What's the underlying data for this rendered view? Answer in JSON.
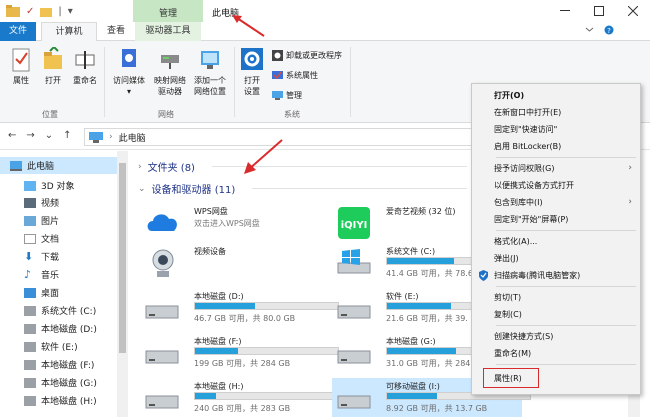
{
  "titlebar": {
    "manage_label": "管理",
    "window_title": "此电脑",
    "qat_check": "✓",
    "qat_divider": "|",
    "qat_dropdown": "▾"
  },
  "tabs": {
    "file": "文件",
    "computer": "计算机",
    "view": "查看",
    "driver_tools": "驱动器工具"
  },
  "ribbon": {
    "location": {
      "properties": "属性",
      "open": "打开",
      "rename": "重命名",
      "label": "位置"
    },
    "network": {
      "access_media": "访问媒体",
      "map_drive": "映射网络\n驱动器",
      "add_location": "添加一个\n网络位置",
      "label": "网络"
    },
    "system": {
      "open_settings": "打开\n设置",
      "uninstall": "卸载或更改程序",
      "sys_properties": "系统属性",
      "manage": "管理",
      "label": "系统"
    }
  },
  "address": {
    "path": "此电脑"
  },
  "sidebar": {
    "items": [
      {
        "label": "此电脑",
        "selected": true
      },
      {
        "label": "3D 对象"
      },
      {
        "label": "视频"
      },
      {
        "label": "图片"
      },
      {
        "label": "文档"
      },
      {
        "label": "下载"
      },
      {
        "label": "音乐"
      },
      {
        "label": "桌面"
      },
      {
        "label": "系统文件 (C:)"
      },
      {
        "label": "本地磁盘 (D:)"
      },
      {
        "label": "软件 (E:)"
      },
      {
        "label": "本地磁盘 (F:)"
      },
      {
        "label": "本地磁盘 (G:)"
      },
      {
        "label": "本地磁盘 (H:)"
      }
    ]
  },
  "content": {
    "folders_header": "文件夹 (8)",
    "devices_header": "设备和驱动器 (11)",
    "tiles": [
      {
        "name": "WPS网盘",
        "sub": "双击进入WPS网盘"
      },
      {
        "name": "爱奇艺视频 (32 位)"
      },
      {
        "name": "视频设备"
      },
      {
        "name": "系统文件 (C:)",
        "free": "41.4 GB 可用，共 78.6 GB",
        "fill": 0.47
      },
      {
        "name": "本地磁盘 (D:)",
        "free": "46.7 GB 可用，共 80.0 GB",
        "fill": 0.42
      },
      {
        "name": "软件 (E:)",
        "free": "21.6 GB 可用，共 39.",
        "fill": 0.45
      },
      {
        "name": "本地磁盘 (F:)",
        "free": "199 GB 可用，共 284 GB",
        "fill": 0.3
      },
      {
        "name": "本地磁盘 (G:)",
        "free": "31.0 GB 可用，共 284 GB",
        "fill": 0.48
      },
      {
        "name": "本地磁盘 (H:)",
        "free": "240 GB 可用，共 283 GB",
        "fill": 0.15
      },
      {
        "name": "可移动磁盘 (I:)",
        "free": "8.92 GB 可用，共 13.7 GB",
        "fill": 0.35
      }
    ]
  },
  "context_menu": {
    "items": [
      {
        "label": "打开(O)",
        "bold": true
      },
      {
        "label": "在新窗口中打开(E)"
      },
      {
        "label": "固定到\"快速访问\""
      },
      {
        "label": "启用 BitLocker(B)"
      },
      {
        "label": "授予访问权限(G)",
        "submenu": true
      },
      {
        "label": "以便携式设备方式打开"
      },
      {
        "label": "包含到库中(I)",
        "submenu": true
      },
      {
        "label": "固定到\"开始\"屏幕(P)"
      },
      {
        "label": "格式化(A)..."
      },
      {
        "label": "弹出(J)"
      },
      {
        "label": "扫描病毒(腾讯电脑管家)"
      },
      {
        "label": "剪切(T)"
      },
      {
        "label": "复制(C)"
      },
      {
        "label": "创建快捷方式(S)"
      },
      {
        "label": "重命名(M)"
      },
      {
        "label": "属性(R)"
      }
    ]
  },
  "colors": {
    "accent": "#1979ca",
    "manage_tab": "#c6e6c4",
    "drive_bar": "#26a0da",
    "selection": "#cce8ff",
    "annotation": "#d92b2b"
  }
}
